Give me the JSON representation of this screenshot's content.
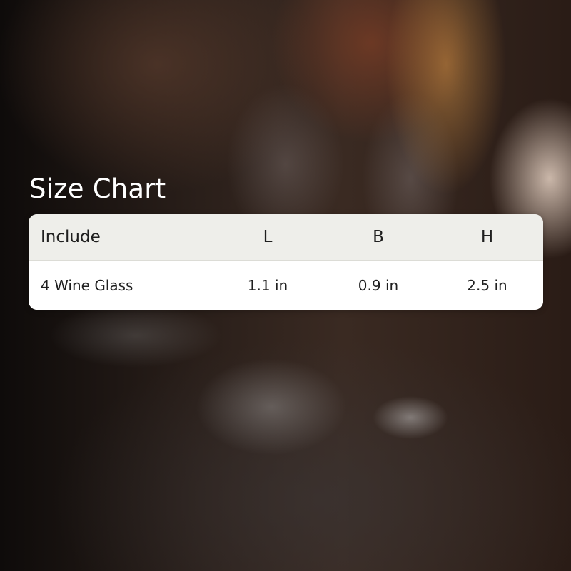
{
  "title": "Size Chart",
  "table": {
    "headers": [
      "Include",
      "L",
      "B",
      "H"
    ],
    "rows": [
      [
        "4 Wine Glass",
        "1.1 in",
        "0.9 in",
        "2.5 in"
      ]
    ]
  },
  "colors": {
    "header_bg": "#eeeeea",
    "body_bg": "#ffffff",
    "text": "#1f1f1f",
    "title": "#ffffff"
  }
}
